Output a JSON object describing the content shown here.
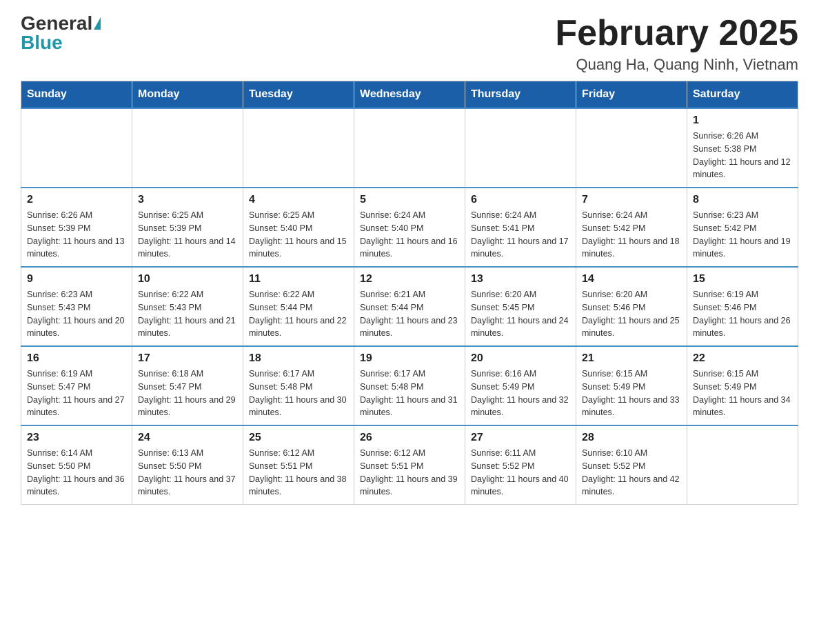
{
  "header": {
    "logo_general": "General",
    "logo_blue": "Blue",
    "month_title": "February 2025",
    "location": "Quang Ha, Quang Ninh, Vietnam"
  },
  "days_of_week": [
    "Sunday",
    "Monday",
    "Tuesday",
    "Wednesday",
    "Thursday",
    "Friday",
    "Saturday"
  ],
  "weeks": [
    [
      {
        "day": "",
        "info": ""
      },
      {
        "day": "",
        "info": ""
      },
      {
        "day": "",
        "info": ""
      },
      {
        "day": "",
        "info": ""
      },
      {
        "day": "",
        "info": ""
      },
      {
        "day": "",
        "info": ""
      },
      {
        "day": "1",
        "info": "Sunrise: 6:26 AM\nSunset: 5:38 PM\nDaylight: 11 hours and 12 minutes."
      }
    ],
    [
      {
        "day": "2",
        "info": "Sunrise: 6:26 AM\nSunset: 5:39 PM\nDaylight: 11 hours and 13 minutes."
      },
      {
        "day": "3",
        "info": "Sunrise: 6:25 AM\nSunset: 5:39 PM\nDaylight: 11 hours and 14 minutes."
      },
      {
        "day": "4",
        "info": "Sunrise: 6:25 AM\nSunset: 5:40 PM\nDaylight: 11 hours and 15 minutes."
      },
      {
        "day": "5",
        "info": "Sunrise: 6:24 AM\nSunset: 5:40 PM\nDaylight: 11 hours and 16 minutes."
      },
      {
        "day": "6",
        "info": "Sunrise: 6:24 AM\nSunset: 5:41 PM\nDaylight: 11 hours and 17 minutes."
      },
      {
        "day": "7",
        "info": "Sunrise: 6:24 AM\nSunset: 5:42 PM\nDaylight: 11 hours and 18 minutes."
      },
      {
        "day": "8",
        "info": "Sunrise: 6:23 AM\nSunset: 5:42 PM\nDaylight: 11 hours and 19 minutes."
      }
    ],
    [
      {
        "day": "9",
        "info": "Sunrise: 6:23 AM\nSunset: 5:43 PM\nDaylight: 11 hours and 20 minutes."
      },
      {
        "day": "10",
        "info": "Sunrise: 6:22 AM\nSunset: 5:43 PM\nDaylight: 11 hours and 21 minutes."
      },
      {
        "day": "11",
        "info": "Sunrise: 6:22 AM\nSunset: 5:44 PM\nDaylight: 11 hours and 22 minutes."
      },
      {
        "day": "12",
        "info": "Sunrise: 6:21 AM\nSunset: 5:44 PM\nDaylight: 11 hours and 23 minutes."
      },
      {
        "day": "13",
        "info": "Sunrise: 6:20 AM\nSunset: 5:45 PM\nDaylight: 11 hours and 24 minutes."
      },
      {
        "day": "14",
        "info": "Sunrise: 6:20 AM\nSunset: 5:46 PM\nDaylight: 11 hours and 25 minutes."
      },
      {
        "day": "15",
        "info": "Sunrise: 6:19 AM\nSunset: 5:46 PM\nDaylight: 11 hours and 26 minutes."
      }
    ],
    [
      {
        "day": "16",
        "info": "Sunrise: 6:19 AM\nSunset: 5:47 PM\nDaylight: 11 hours and 27 minutes."
      },
      {
        "day": "17",
        "info": "Sunrise: 6:18 AM\nSunset: 5:47 PM\nDaylight: 11 hours and 29 minutes."
      },
      {
        "day": "18",
        "info": "Sunrise: 6:17 AM\nSunset: 5:48 PM\nDaylight: 11 hours and 30 minutes."
      },
      {
        "day": "19",
        "info": "Sunrise: 6:17 AM\nSunset: 5:48 PM\nDaylight: 11 hours and 31 minutes."
      },
      {
        "day": "20",
        "info": "Sunrise: 6:16 AM\nSunset: 5:49 PM\nDaylight: 11 hours and 32 minutes."
      },
      {
        "day": "21",
        "info": "Sunrise: 6:15 AM\nSunset: 5:49 PM\nDaylight: 11 hours and 33 minutes."
      },
      {
        "day": "22",
        "info": "Sunrise: 6:15 AM\nSunset: 5:49 PM\nDaylight: 11 hours and 34 minutes."
      }
    ],
    [
      {
        "day": "23",
        "info": "Sunrise: 6:14 AM\nSunset: 5:50 PM\nDaylight: 11 hours and 36 minutes."
      },
      {
        "day": "24",
        "info": "Sunrise: 6:13 AM\nSunset: 5:50 PM\nDaylight: 11 hours and 37 minutes."
      },
      {
        "day": "25",
        "info": "Sunrise: 6:12 AM\nSunset: 5:51 PM\nDaylight: 11 hours and 38 minutes."
      },
      {
        "day": "26",
        "info": "Sunrise: 6:12 AM\nSunset: 5:51 PM\nDaylight: 11 hours and 39 minutes."
      },
      {
        "day": "27",
        "info": "Sunrise: 6:11 AM\nSunset: 5:52 PM\nDaylight: 11 hours and 40 minutes."
      },
      {
        "day": "28",
        "info": "Sunrise: 6:10 AM\nSunset: 5:52 PM\nDaylight: 11 hours and 42 minutes."
      },
      {
        "day": "",
        "info": ""
      }
    ]
  ]
}
